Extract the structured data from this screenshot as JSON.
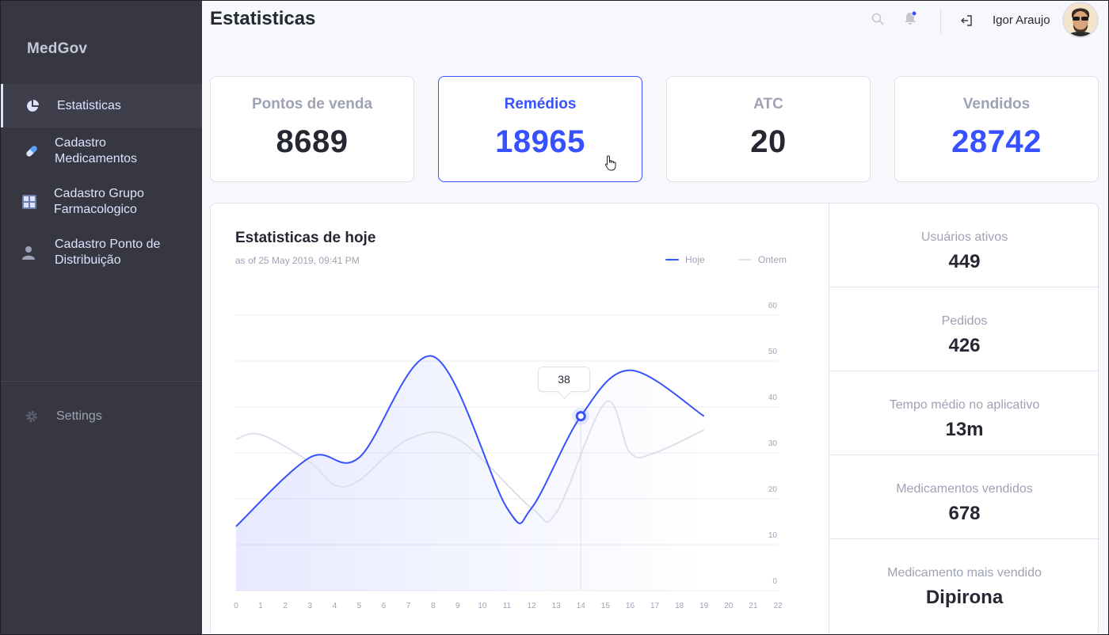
{
  "sidebar": {
    "brand": "MedGov",
    "items": [
      {
        "label": "Estatisticas",
        "icon": "pie-chart-icon",
        "active": true
      },
      {
        "label": "Cadastro\nMedicamentos",
        "icon": "pill-icon"
      },
      {
        "label": "Cadastro Grupo\nFarmacologico",
        "icon": "grid-icon"
      },
      {
        "label": "Cadastro Ponto de\nDistribuição",
        "icon": "user-icon"
      }
    ],
    "settings": {
      "label": "Settings",
      "icon": "gear-icon"
    }
  },
  "header": {
    "title": "Estatisticas",
    "user_name": "Igor Araujo"
  },
  "cards": [
    {
      "title": "Pontos de venda",
      "value": "8689"
    },
    {
      "title": "Remédios",
      "value": "18965",
      "active": true
    },
    {
      "title": "ATC",
      "value": "20"
    },
    {
      "title": "Vendidos",
      "value": "28742",
      "highlight": true
    }
  ],
  "chart": {
    "title": "Estatisticas de hoje",
    "subtitle": "as of 25 May 2019, 09:41 PM",
    "legend": [
      "Hoje",
      "Ontem"
    ],
    "tooltip": "38"
  },
  "chart_data": {
    "type": "line",
    "x_ticks": [
      0,
      1,
      2,
      3,
      4,
      5,
      6,
      7,
      8,
      9,
      10,
      11,
      12,
      13,
      14,
      15,
      16,
      17,
      18,
      19,
      20,
      21,
      22
    ],
    "y_ticks": [
      0,
      10,
      20,
      30,
      40,
      50,
      60
    ],
    "ylim": [
      0,
      60
    ],
    "xlim": [
      0,
      22
    ],
    "grid": true,
    "legend_position": "top-right",
    "series": [
      {
        "name": "Hoje",
        "color": "#3751ff",
        "points": [
          [
            0,
            14
          ],
          [
            3,
            29
          ],
          [
            5,
            29
          ],
          [
            8,
            51
          ],
          [
            11,
            18
          ],
          [
            12,
            18
          ],
          [
            14,
            38
          ],
          [
            16,
            48
          ],
          [
            19,
            38
          ]
        ]
      },
      {
        "name": "Ontem",
        "color": "#dfe0eb",
        "points": [
          [
            0,
            33
          ],
          [
            1,
            34
          ],
          [
            3,
            28
          ],
          [
            4,
            23
          ],
          [
            5,
            24
          ],
          [
            7,
            33
          ],
          [
            9,
            33
          ],
          [
            12,
            18
          ],
          [
            13,
            17
          ],
          [
            15,
            41
          ],
          [
            16,
            30
          ],
          [
            17,
            30
          ],
          [
            19,
            35
          ]
        ]
      }
    ],
    "highlight": {
      "x": 14,
      "y": 38
    }
  },
  "stats": [
    {
      "label": "Usuários ativos",
      "value": "449"
    },
    {
      "label": "Pedidos",
      "value": "426"
    },
    {
      "label": "Tempo médio no aplicativo",
      "value": "13m"
    },
    {
      "label": "Medicamentos vendidos",
      "value": "678"
    },
    {
      "label": "Medicamento mais vendido",
      "value": "Dipirona"
    }
  ]
}
